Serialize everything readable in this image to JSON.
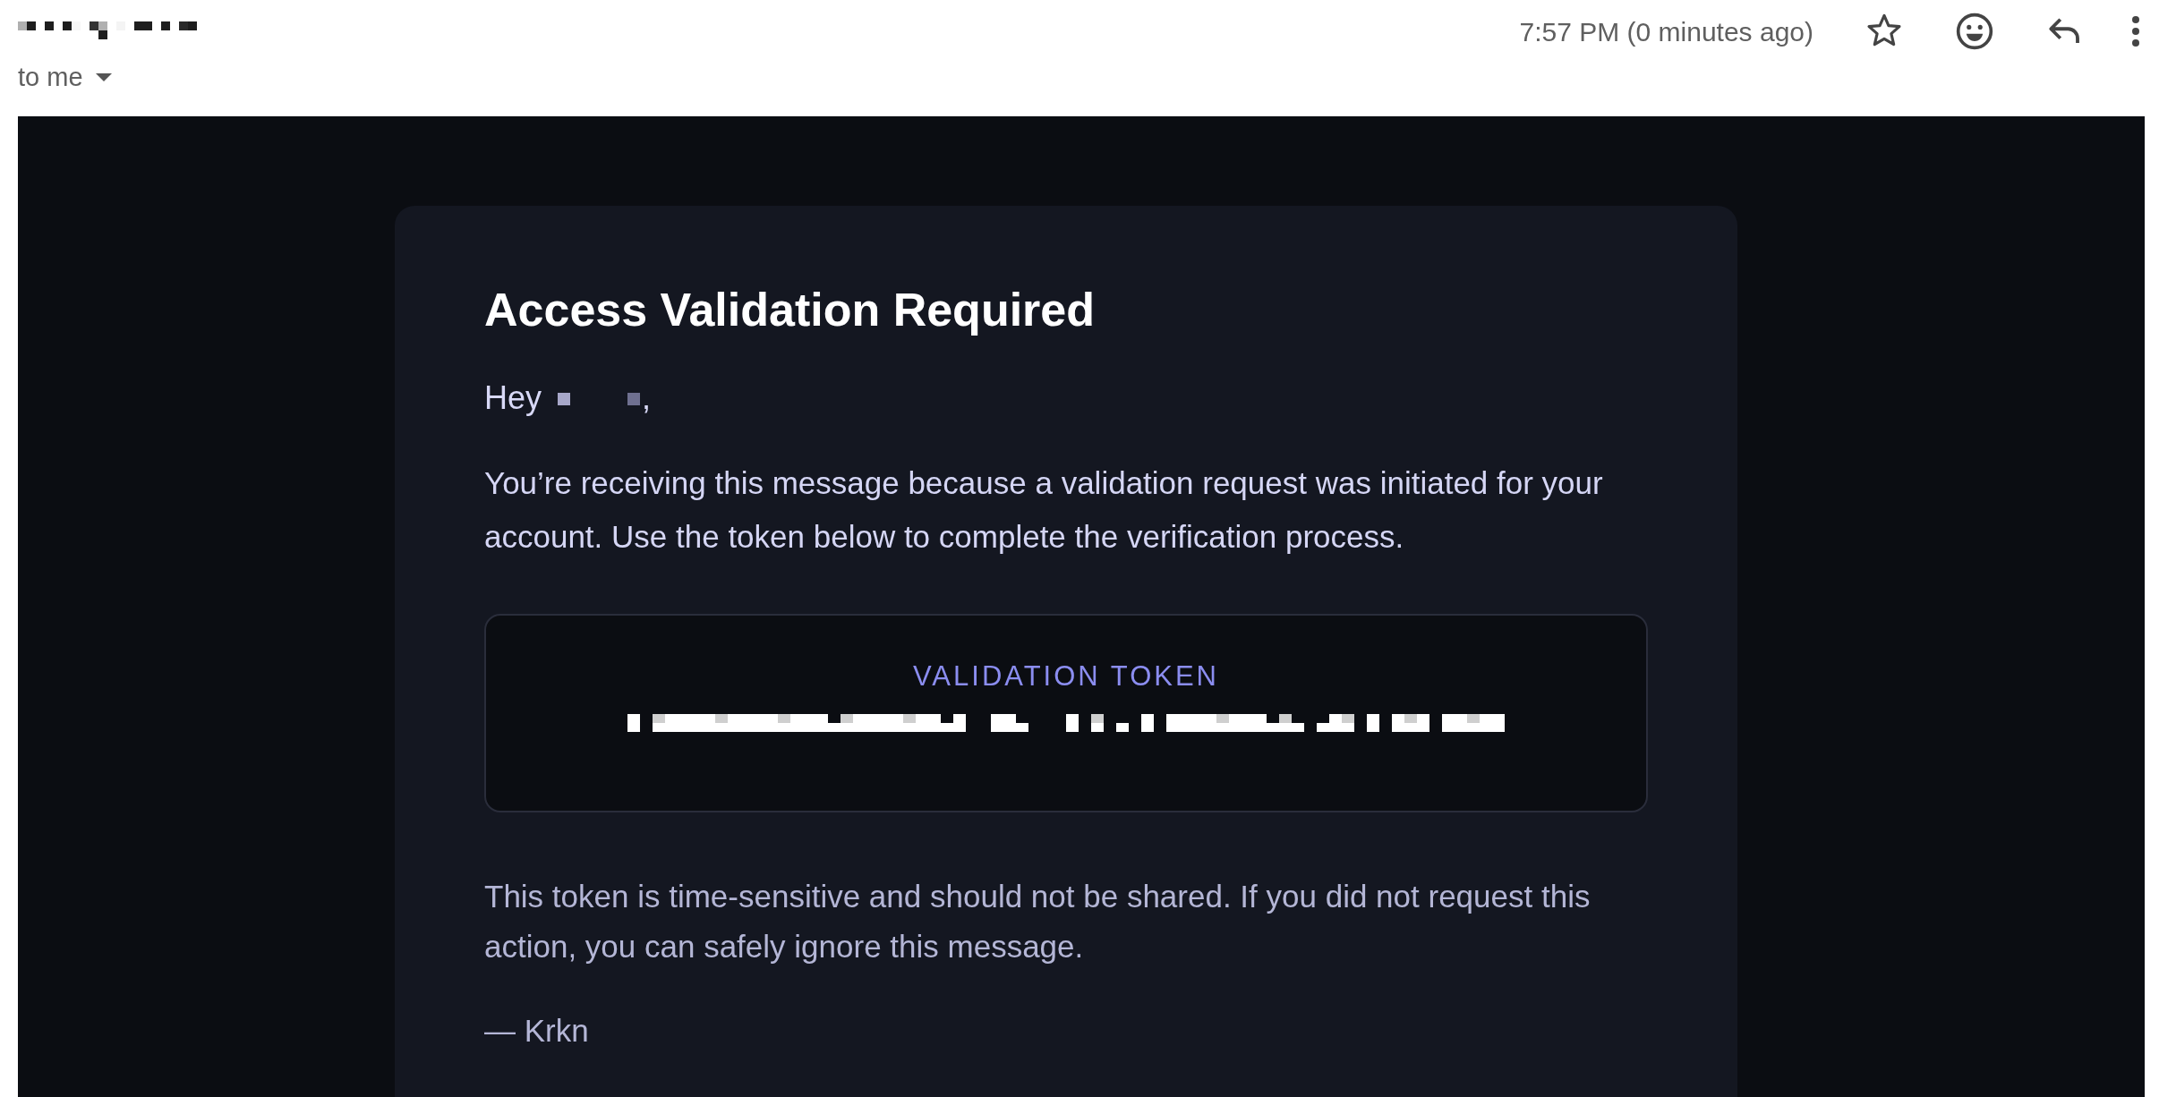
{
  "header": {
    "recipient": "to me",
    "time": "7:57 PM (0 minutes ago)"
  },
  "email": {
    "title": "Access Validation Required",
    "greeting": {
      "prefix": "Hey",
      "suffix": ","
    },
    "intro": "You’re receiving this message because a validation request was initiated for your account. Use the token below to complete the verification process.",
    "token_box": {
      "label": "VALIDATION TOKEN"
    },
    "notice": "This token is time-sensitive and should not be shared. If you did not request this action, you can safely ignore this message.",
    "signature": "— Krkn"
  }
}
